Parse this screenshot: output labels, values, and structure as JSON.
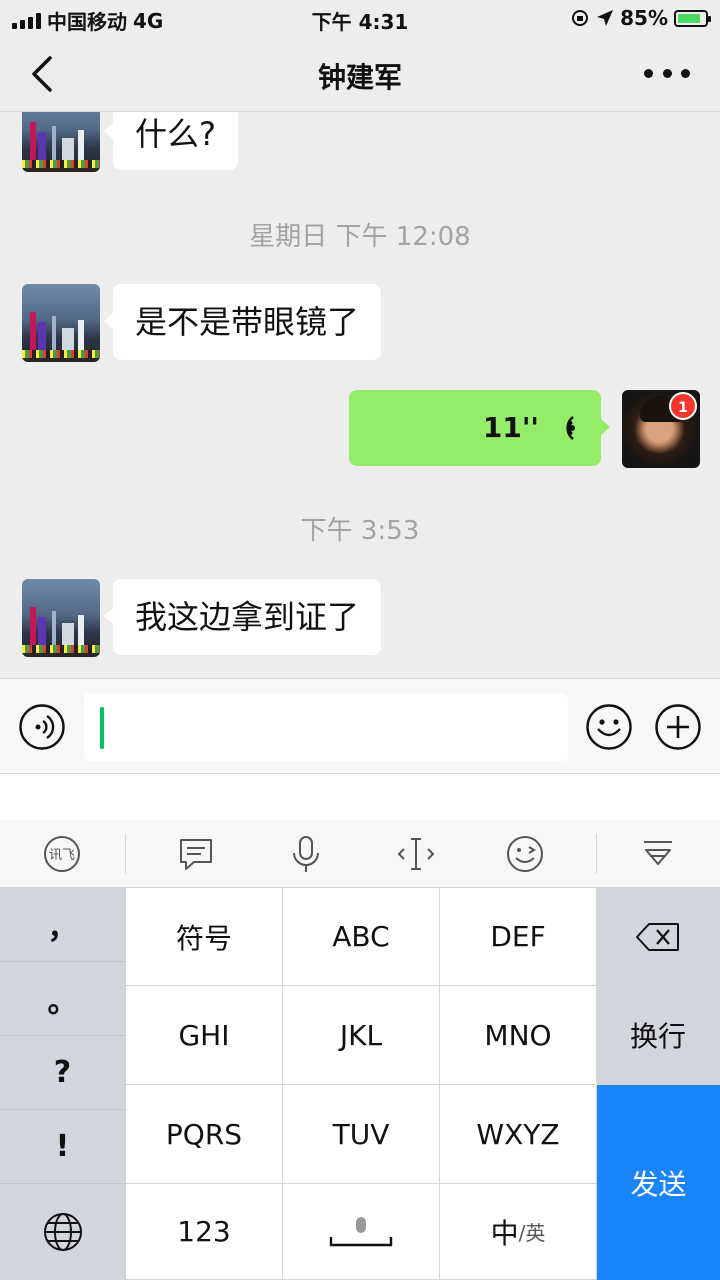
{
  "status_bar": {
    "carrier": "中国移动",
    "network": "4G",
    "time": "下午 4:31",
    "battery_percent": "85%",
    "battery_level": 0.85
  },
  "nav": {
    "title": "钟建军",
    "back_icon": "chevron-left-icon",
    "more_icon": "ellipsis-icon"
  },
  "chat": {
    "messages": [
      {
        "side": "in",
        "text": "什么?"
      },
      {
        "type": "time",
        "text": "星期日 下午 12:08"
      },
      {
        "side": "in",
        "text": "是不是带眼镜了"
      },
      {
        "side": "out",
        "type": "voice",
        "duration": "11''",
        "badge": "1"
      },
      {
        "type": "time",
        "text": "下午 3:53"
      },
      {
        "side": "in",
        "text": "我这边拿到证了"
      }
    ]
  },
  "input_bar": {
    "voice_icon": "voice-input-icon",
    "emoji_icon": "emoji-icon",
    "plus_icon": "plus-icon"
  },
  "keyboard_toolbar": {
    "icons": [
      "xunfei-logo-icon",
      "message-icon",
      "microphone-icon",
      "cursor-icon",
      "emoji-wink-icon",
      "collapse-keyboard-icon"
    ]
  },
  "keyboard": {
    "symbols": [
      "，",
      "。",
      "?",
      "!"
    ],
    "globe_icon": "globe-icon",
    "rows": [
      [
        "符号",
        "ABC",
        "DEF"
      ],
      [
        "GHI",
        "JKL",
        "MNO"
      ],
      [
        "PQRS",
        "TUV",
        "WXYZ"
      ]
    ],
    "bottom": {
      "numbers": "123",
      "space_icon": "space-mic-icon",
      "lang_main": "中",
      "lang_sub": "/英"
    },
    "delete_icon": "backspace-icon",
    "newline": "换行",
    "send": "发送"
  },
  "colors": {
    "accent_green": "#07c160",
    "bubble_out": "#95ec69",
    "send_blue": "#1a85f9",
    "badge_red": "#f43530"
  }
}
